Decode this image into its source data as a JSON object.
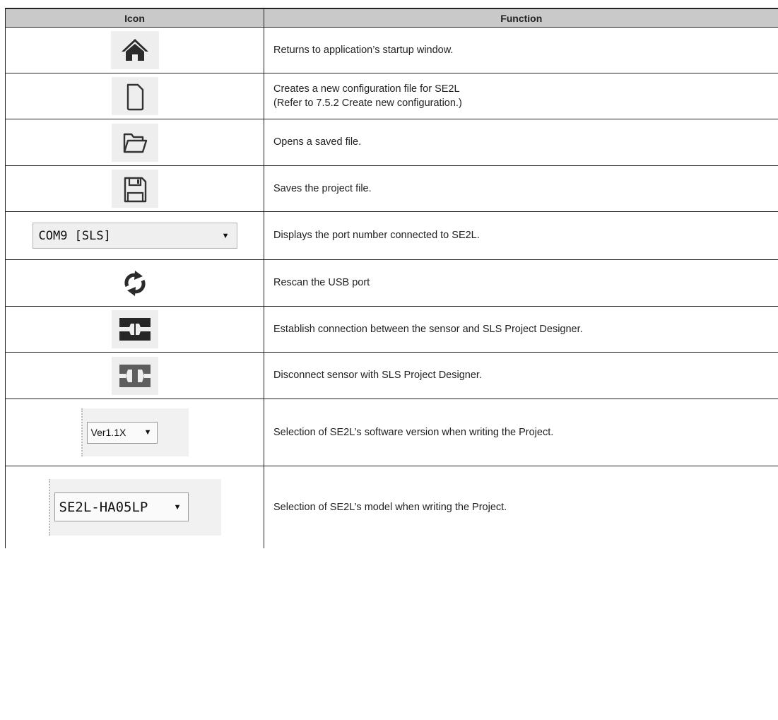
{
  "header": {
    "icon": "Icon",
    "function": "Function"
  },
  "rows": [
    {
      "icon": "home-icon",
      "description": "Returns to application’s startup window."
    },
    {
      "icon": "new-file-icon",
      "description": "Creates a new configuration file for SE2L",
      "description_2": "(Refer to 7.5.2 Create new configuration.)"
    },
    {
      "icon": "open-folder-icon",
      "description": "Opens a saved file."
    },
    {
      "icon": "save-icon",
      "description": "Saves the project file."
    },
    {
      "icon": "port-dropdown",
      "control_value": "COM9 [SLS]",
      "description": "Displays the port number connected to SE2L."
    },
    {
      "icon": "refresh-icon",
      "description": "Rescan the USB port"
    },
    {
      "icon": "connect-icon",
      "description": "Establish connection between the sensor and SLS Project Designer."
    },
    {
      "icon": "disconnect-icon",
      "description": "Disconnect sensor with SLS Project Designer."
    },
    {
      "icon": "version-dropdown",
      "control_value": "Ver1.1X",
      "description": "Selection of SE2L’s software version when writing the Project."
    },
    {
      "icon": "model-dropdown",
      "control_value": "SE2L-HA05LP",
      "description": "Selection of SE2L’s model when writing the Project."
    }
  ]
}
